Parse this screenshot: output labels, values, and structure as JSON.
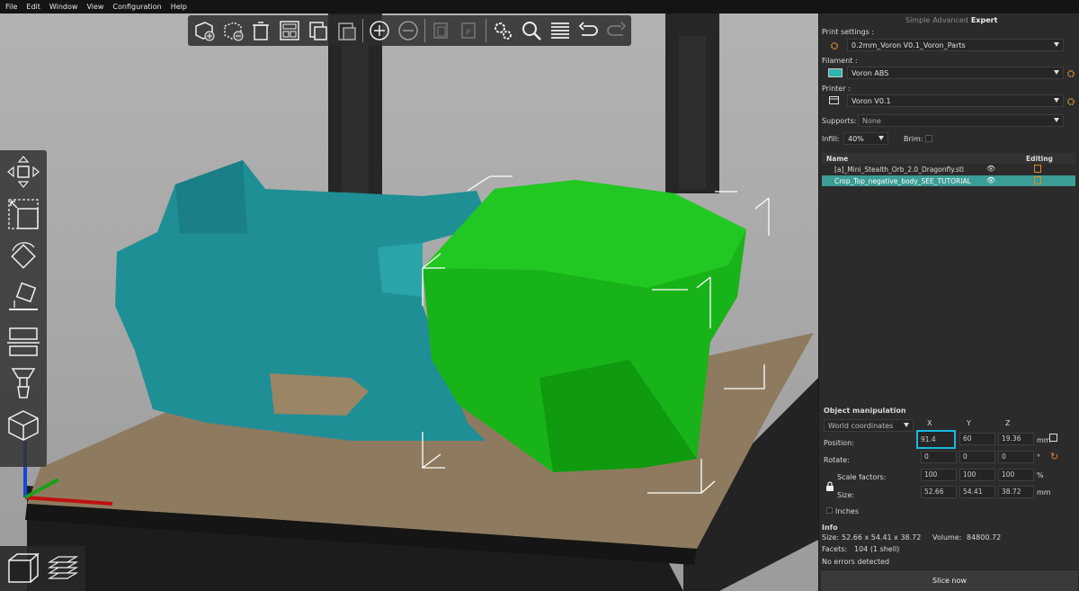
{
  "menu": [
    "File",
    "Edit",
    "Window",
    "View",
    "Configuration",
    "Help"
  ],
  "toolbar_icons": [
    "add-icon",
    "delete-icon",
    "delete-all-icon",
    "arrange-icon",
    "copy-icon",
    "paste-icon",
    "add-instance-icon",
    "remove-instance-icon",
    "split-objects-icon",
    "split-parts-icon",
    "layer-editing-icon",
    "search-icon",
    "variable-layer-icon",
    "undo-icon",
    "redo-icon"
  ],
  "left_tools": [
    "move-icon",
    "scale-icon",
    "rotate-icon",
    "place-on-face-icon",
    "cut-icon",
    "support-paint-icon",
    "seam-paint-icon"
  ],
  "view_buttons": [
    "3d-view-icon",
    "preview-layers-icon"
  ],
  "panel": {
    "mode_tabs": [
      "Simple",
      "Advanced",
      "Expert"
    ],
    "active_mode": "Expert",
    "print_settings_label": "Print settings :",
    "print_settings_value": "0.2mm_Voron V0.1_Voron_Parts",
    "filament_label": "Filament :",
    "filament_value": "Voron ABS",
    "filament_color": "#2eb3b0",
    "printer_label": "Printer :",
    "printer_value": "Voron V0.1",
    "supports_label": "Supports:",
    "supports_value": "None",
    "infill_label": "Infill:",
    "infill_value": "40%",
    "brim_label": "Brim:",
    "objects_header_name": "Name",
    "objects_header_editing": "Editing",
    "objects": [
      {
        "name": "[a]_Mini_Stealth_Orb_2.0_Dragonfly.stl",
        "selected": false
      },
      {
        "name": "Crop_Top_negative_body_SEE_TUTORIAL",
        "selected": true
      }
    ],
    "manip": {
      "title": "Object manipulation",
      "coord_mode": "World coordinates",
      "axis_x": "X",
      "axis_y": "Y",
      "axis_z": "Z",
      "position_label": "Position:",
      "position": [
        "91.4",
        "60",
        "19.36"
      ],
      "position_unit": "mm",
      "rotate_label": "Rotate:",
      "rotate": [
        "0",
        "0",
        "0"
      ],
      "rotate_unit": "°",
      "scale_label": "Scale factors:",
      "scale": [
        "100",
        "100",
        "100"
      ],
      "scale_unit": "%",
      "size_label": "Size:",
      "size": [
        "52.66",
        "54.41",
        "38.72"
      ],
      "size_unit": "mm",
      "inches_label": "Inches"
    },
    "info": {
      "title": "Info",
      "size_label": "Size:",
      "size_value": "52.66 x 54.41 x 38.72",
      "volume_label": "Volume:",
      "volume_value": "84800.72",
      "facets_label": "Facets:",
      "facets_value": "104 (1 shell)",
      "status": "No errors detected"
    },
    "slice_button": "Slice now"
  },
  "colors": {
    "accent": "#3c9c96",
    "model_teal": "#1f8f96",
    "model_green": "#18b318",
    "highlight": "#19b9e0"
  }
}
